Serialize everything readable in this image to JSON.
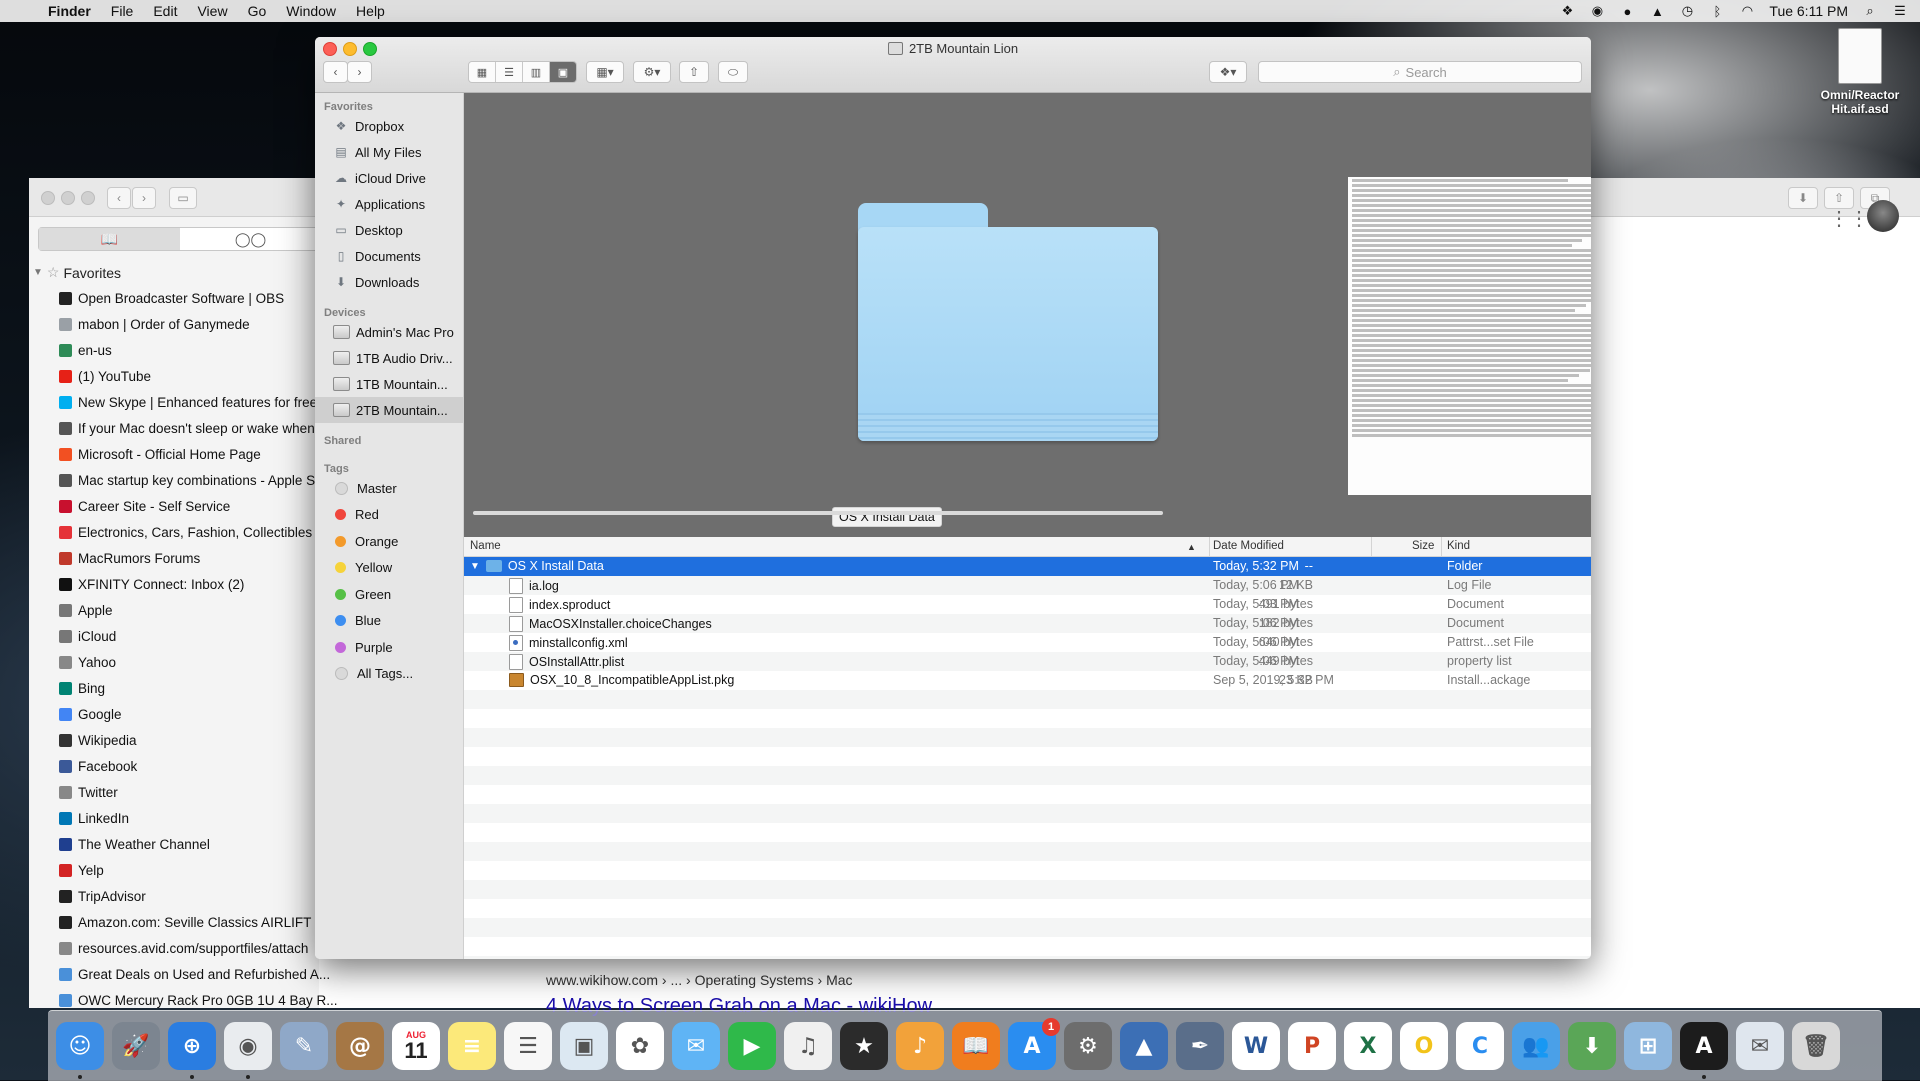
{
  "menubar": {
    "app_name": "Finder",
    "menus": [
      "File",
      "Edit",
      "View",
      "Go",
      "Window",
      "Help"
    ],
    "clock": "Tue 6:11 PM"
  },
  "desktop_icon": {
    "label_line1": "Omni/Reactor",
    "label_line2": "Hit.aif.asd"
  },
  "browser": {
    "favorites_header": "Favorites",
    "favorites": [
      {
        "label": "Open Broadcaster Software | OBS",
        "color": "#222222"
      },
      {
        "label": "mabon | Order of Ganymede",
        "color": "#9aa0a6"
      },
      {
        "label": "en-us",
        "color": "#2e8b57"
      },
      {
        "label": "(1) YouTube",
        "color": "#e62117"
      },
      {
        "label": "New Skype | Enhanced features for free",
        "color": "#00aff0"
      },
      {
        "label": "If your Mac doesn't sleep or wake when expected",
        "color": "#555555"
      },
      {
        "label": "Microsoft - Official Home Page",
        "color": "#f25022"
      },
      {
        "label": "Mac startup key combinations - Apple Support",
        "color": "#555555"
      },
      {
        "label": "Career Site - Self Service",
        "color": "#c8102e"
      },
      {
        "label": "Electronics, Cars, Fashion, Collectibles & More",
        "color": "#e53238"
      },
      {
        "label": "MacRumors Forums",
        "color": "#c0392b"
      },
      {
        "label": "XFINITY Connect: Inbox (2)",
        "color": "#111111"
      },
      {
        "label": "Apple",
        "color": "#777777"
      },
      {
        "label": "iCloud",
        "color": "#777777"
      },
      {
        "label": "Yahoo",
        "color": "#888888"
      },
      {
        "label": "Bing",
        "color": "#008373"
      },
      {
        "label": "Google",
        "color": "#4285f4"
      },
      {
        "label": "Wikipedia",
        "color": "#333333"
      },
      {
        "label": "Facebook",
        "color": "#3b5998"
      },
      {
        "label": "Twitter",
        "color": "#888888"
      },
      {
        "label": "LinkedIn",
        "color": "#0077b5"
      },
      {
        "label": "The Weather Channel",
        "color": "#1f3f8f"
      },
      {
        "label": "Yelp",
        "color": "#d32323"
      },
      {
        "label": "TripAdvisor",
        "color": "#222222"
      },
      {
        "label": "Amazon.com: Seville Classics AIRLIFT",
        "color": "#222222"
      },
      {
        "label": "resources.avid.com/supportfiles/attach",
        "color": "#888888"
      },
      {
        "label": "Great Deals on Used and Refurbished A...",
        "color": "#4a90d9"
      },
      {
        "label": "OWC Mercury Rack Pro 0GB 1U 4 Bay R...",
        "color": "#4a90d9"
      }
    ],
    "result_url": "www.wikihow.com › ... › Operating Systems › Mac",
    "result_title": "4 Ways to Screen Grab on a Mac - wikiHow"
  },
  "finder": {
    "title": "2TB Mountain Lion",
    "search_placeholder": "Search",
    "sidebar": {
      "favorites_header": "Favorites",
      "favorites": [
        {
          "label": "Dropbox",
          "icon": "dropbox-icon"
        },
        {
          "label": "All My Files",
          "icon": "all-files-icon"
        },
        {
          "label": "iCloud Drive",
          "icon": "cloud-icon"
        },
        {
          "label": "Applications",
          "icon": "applications-icon"
        },
        {
          "label": "Desktop",
          "icon": "desktop-icon"
        },
        {
          "label": "Documents",
          "icon": "documents-icon"
        },
        {
          "label": "Downloads",
          "icon": "downloads-icon"
        }
      ],
      "devices_header": "Devices",
      "devices": [
        {
          "label": "Admin's Mac Pro"
        },
        {
          "label": "1TB Audio Driv..."
        },
        {
          "label": "1TB Mountain..."
        },
        {
          "label": "2TB Mountain..."
        }
      ],
      "shared_header": "Shared",
      "tags_header": "Tags",
      "tags": [
        {
          "label": "Master",
          "color": "#d9d9d9"
        },
        {
          "label": "Red",
          "color": "#f0463c"
        },
        {
          "label": "Orange",
          "color": "#f39a2b"
        },
        {
          "label": "Yellow",
          "color": "#f6d33a"
        },
        {
          "label": "Green",
          "color": "#56c046"
        },
        {
          "label": "Blue",
          "color": "#3d8ef0"
        },
        {
          "label": "Purple",
          "color": "#c368d9"
        },
        {
          "label": "All Tags...",
          "color": "#d9d9d9"
        }
      ]
    },
    "cover_flow": {
      "folder_label": "OS X Install Data"
    },
    "columns": {
      "name": "Name",
      "date": "Date Modified",
      "size": "Size",
      "kind": "Kind"
    },
    "files": [
      {
        "name": "OS X Install Data",
        "date": "Today, 5:32 PM",
        "size": "--",
        "kind": "Folder",
        "type": "folder"
      },
      {
        "name": "ia.log",
        "date": "Today, 5:06 PM",
        "size": "12 KB",
        "kind": "Log File",
        "type": "doc"
      },
      {
        "name": "index.sproduct",
        "date": "Today, 5:03 PM",
        "size": "491 bytes",
        "kind": "Document",
        "type": "doc"
      },
      {
        "name": "MacOSXInstaller.choiceChanges",
        "date": "Today, 5:06 PM",
        "size": "182 bytes",
        "kind": "Document",
        "type": "doc"
      },
      {
        "name": "minstallconfig.xml",
        "date": "Today, 5:06 PM",
        "size": "640 bytes",
        "kind": "Pattrst...set File",
        "type": "xml"
      },
      {
        "name": "OSInstallAttr.plist",
        "date": "Today, 5:06 PM",
        "size": "449 bytes",
        "kind": "property list",
        "type": "doc"
      },
      {
        "name": "OSX_10_8_IncompatibleAppList.pkg",
        "date": "Sep 5, 2019, 5:32 PM",
        "size": "23 KB",
        "kind": "Install...ackage",
        "type": "pkg"
      }
    ]
  },
  "dock": {
    "calendar_month": "AUG",
    "calendar_day": "11",
    "app_store_badge": "1",
    "apps": [
      {
        "name": "finder",
        "bg": "#3d8ee6",
        "glyph": "☺"
      },
      {
        "name": "launchpad",
        "bg": "#7c8590",
        "glyph": "🚀"
      },
      {
        "name": "safari",
        "bg": "#2a7de1",
        "glyph": "⊕"
      },
      {
        "name": "chrome",
        "bg": "#e9ecef",
        "glyph": "◉"
      },
      {
        "name": "preview",
        "bg": "#8fa8c8",
        "glyph": "✎"
      },
      {
        "name": "contacts",
        "bg": "#a57745",
        "glyph": "@"
      },
      {
        "name": "calendar",
        "bg": "#ffffff",
        "glyph": ""
      },
      {
        "name": "notes",
        "bg": "#fce97a",
        "glyph": "≡"
      },
      {
        "name": "reminders",
        "bg": "#f7f7f7",
        "glyph": "☰"
      },
      {
        "name": "photo-booth",
        "bg": "#dce8f2",
        "glyph": "▣"
      },
      {
        "name": "photos",
        "bg": "#ffffff",
        "glyph": "✿"
      },
      {
        "name": "messages",
        "bg": "#5fb4f5",
        "glyph": "✉"
      },
      {
        "name": "facetime",
        "bg": "#2fb94a",
        "glyph": "▶"
      },
      {
        "name": "itunes",
        "bg": "#f0f0f0",
        "glyph": "♫"
      },
      {
        "name": "imovie",
        "bg": "#2b2b2b",
        "glyph": "★"
      },
      {
        "name": "garageband",
        "bg": "#f2a23a",
        "glyph": "♪"
      },
      {
        "name": "ibooks",
        "bg": "#f07d1e",
        "glyph": "📖"
      },
      {
        "name": "app-store",
        "bg": "#2a8df0",
        "glyph": "A"
      },
      {
        "name": "system-preferences",
        "bg": "#6d6d6d",
        "glyph": "⚙"
      },
      {
        "name": "keynote",
        "bg": "#3c6fb5",
        "glyph": "▲"
      },
      {
        "name": "script-editor",
        "bg": "#5a6e8a",
        "glyph": "✒"
      },
      {
        "name": "word",
        "bg": "#ffffff",
        "glyph": "W"
      },
      {
        "name": "powerpoint",
        "bg": "#ffffff",
        "glyph": "P"
      },
      {
        "name": "excel",
        "bg": "#ffffff",
        "glyph": "X"
      },
      {
        "name": "outlook-o",
        "bg": "#ffffff",
        "glyph": "O"
      },
      {
        "name": "c-app",
        "bg": "#ffffff",
        "glyph": "C"
      },
      {
        "name": "lync",
        "bg": "#4aa0e8",
        "glyph": "👥"
      },
      {
        "name": "network-app",
        "bg": "#5aa657",
        "glyph": "⬇"
      },
      {
        "name": "windows-app",
        "bg": "#8fb7de",
        "glyph": "⊞"
      },
      {
        "name": "avid",
        "bg": "#1c1c1c",
        "glyph": "A"
      },
      {
        "name": "downloads-stack",
        "bg": "#dfe6ee",
        "glyph": "✉"
      },
      {
        "name": "trash",
        "bg": "#d8d8d8",
        "glyph": "🗑"
      }
    ]
  }
}
